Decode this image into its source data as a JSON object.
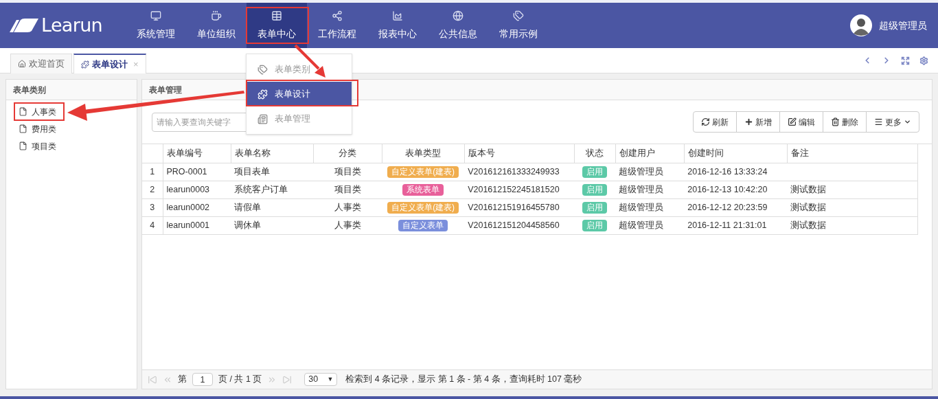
{
  "header": {
    "logo_text": "Learun",
    "nav": [
      {
        "label": "系统管理",
        "selected": false
      },
      {
        "label": "单位组织",
        "selected": false
      },
      {
        "label": "表单中心",
        "selected": true
      },
      {
        "label": "工作流程",
        "selected": false
      },
      {
        "label": "报表中心",
        "selected": false
      },
      {
        "label": "公共信息",
        "selected": false
      },
      {
        "label": "常用示例",
        "selected": false
      }
    ],
    "user": "超级管理员"
  },
  "tabs": [
    {
      "label": "欢迎首页",
      "selected": false
    },
    {
      "label": "表单设计",
      "selected": true,
      "close": "×"
    }
  ],
  "menu": {
    "items": [
      {
        "label": "表单类别",
        "selected": false
      },
      {
        "label": "表单设计",
        "selected": true
      },
      {
        "label": "表单管理",
        "selected": false
      }
    ]
  },
  "sidebar": {
    "title": "表单类别",
    "items": [
      {
        "label": "人事类"
      },
      {
        "label": "费用类"
      },
      {
        "label": "项目类"
      }
    ]
  },
  "main": {
    "title": "表单管理",
    "search": {
      "placeholder": "请输入要查询关键字"
    },
    "toolbar": [
      "刷新",
      "新增",
      "编辑",
      "删除",
      "更多"
    ],
    "table": {
      "columns": [
        "表单编号",
        "表单名称",
        "分类",
        "表单类型",
        "版本号",
        "状态",
        "创建用户",
        "创建时间",
        "备注"
      ],
      "rows": [
        {
          "index": "1",
          "code": "PRO-0001",
          "name": "项目表单",
          "category": "项目类",
          "type": {
            "label": "自定义表单(建表)",
            "color": "#f0ad4e"
          },
          "version": "V201612161333249933",
          "status": {
            "label": "启用",
            "color": "#5cc9a7"
          },
          "user": "超级管理员",
          "time": "2016-12-16 13:33:24",
          "note": ""
        },
        {
          "index": "2",
          "code": "learun0003",
          "name": "系统客户订单",
          "category": "项目类",
          "type": {
            "label": "系统表单",
            "color": "#e8609a"
          },
          "version": "V201612152245181520",
          "status": {
            "label": "启用",
            "color": "#5cc9a7"
          },
          "user": "超级管理员",
          "time": "2016-12-13 10:42:20",
          "note": "测试数据"
        },
        {
          "index": "3",
          "code": "learun0002",
          "name": "请假单",
          "category": "人事类",
          "type": {
            "label": "自定义表单(建表)",
            "color": "#f0ad4e"
          },
          "version": "V201612151916455780",
          "status": {
            "label": "启用",
            "color": "#5cc9a7"
          },
          "user": "超级管理员",
          "time": "2016-12-12 20:23:59",
          "note": "测试数据"
        },
        {
          "index": "4",
          "code": "learun0001",
          "name": "调休单",
          "category": "人事类",
          "type": {
            "label": "自定义表单",
            "color": "#7b8fdc"
          },
          "version": "V201612151204458560",
          "status": {
            "label": "启用",
            "color": "#5cc9a7"
          },
          "user": "超级管理员",
          "time": "2016-12-11 21:31:01",
          "note": "测试数据"
        }
      ]
    },
    "pager": {
      "prefix": "第",
      "page": "1",
      "suffix": "页 / 共 1 页",
      "size": "30",
      "size_caret": "▼",
      "summary": "检索到 4 条记录，显示 第 1 条 - 第 4 条，查询耗时 107 毫秒"
    }
  }
}
